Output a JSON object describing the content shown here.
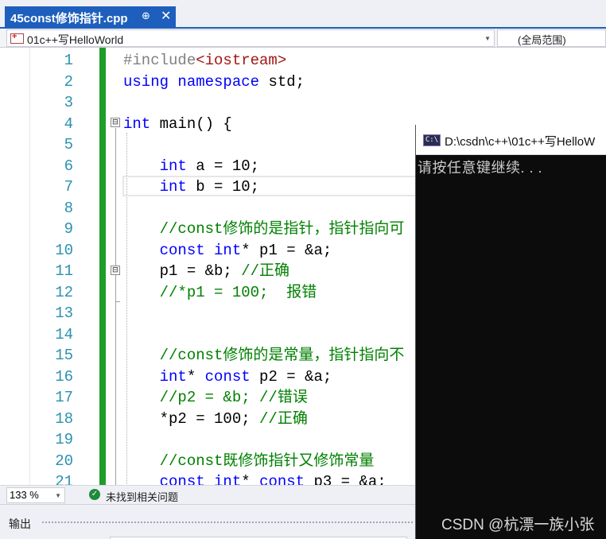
{
  "tab": {
    "title": "45const修饰指针.cpp",
    "pin": "⊕",
    "close": "✕"
  },
  "nav": {
    "project": "01c++写HelloWorld",
    "scope": "(全局范围)",
    "dropdown_glyph": "▼"
  },
  "editor": {
    "line_numbers": [
      "1",
      "2",
      "3",
      "4",
      "5",
      "6",
      "7",
      "8",
      "9",
      "10",
      "11",
      "12",
      "13",
      "14",
      "15",
      "16",
      "17",
      "18",
      "19",
      "20",
      "21"
    ],
    "lines": [
      [
        {
          "t": "#include",
          "c": "pp"
        },
        {
          "t": "<iostream>",
          "c": "inc"
        }
      ],
      [
        {
          "t": "using",
          "c": "kw"
        },
        {
          "t": " "
        },
        {
          "t": "namespace",
          "c": "kw"
        },
        {
          "t": " std;"
        }
      ],
      [],
      [
        {
          "t": "int",
          "c": "kw"
        },
        {
          "t": " main() {"
        }
      ],
      [],
      [
        {
          "t": "    "
        },
        {
          "t": "int",
          "c": "kw"
        },
        {
          "t": " a = 10;"
        }
      ],
      [
        {
          "t": "    "
        },
        {
          "t": "int",
          "c": "kw"
        },
        {
          "t": " b = 10;"
        }
      ],
      [],
      [
        {
          "t": "    "
        },
        {
          "t": "//const修饰的是指针，指针指向可",
          "c": "cm"
        }
      ],
      [
        {
          "t": "    "
        },
        {
          "t": "const",
          "c": "kw"
        },
        {
          "t": " "
        },
        {
          "t": "int",
          "c": "kw"
        },
        {
          "t": "* p1 = &a;"
        }
      ],
      [
        {
          "t": "    p1 = &b; "
        },
        {
          "t": "//正确",
          "c": "cm"
        }
      ],
      [
        {
          "t": "    "
        },
        {
          "t": "//*p1 = 100;  报错",
          "c": "cm"
        }
      ],
      [],
      [],
      [
        {
          "t": "    "
        },
        {
          "t": "//const修饰的是常量，指针指向不",
          "c": "cm"
        }
      ],
      [
        {
          "t": "    "
        },
        {
          "t": "int",
          "c": "kw"
        },
        {
          "t": "* "
        },
        {
          "t": "const",
          "c": "kw"
        },
        {
          "t": " p2 = &a;"
        }
      ],
      [
        {
          "t": "    "
        },
        {
          "t": "//p2 = &b; //错误",
          "c": "cm"
        }
      ],
      [
        {
          "t": "    *p2 = 100; "
        },
        {
          "t": "//正确",
          "c": "cm"
        }
      ],
      [],
      [
        {
          "t": "    "
        },
        {
          "t": "//const既修饰指针又修饰常量",
          "c": "cm"
        }
      ],
      [
        {
          "t": "    "
        },
        {
          "t": "const",
          "c": "kw"
        },
        {
          "t": " "
        },
        {
          "t": "int",
          "c": "kw"
        },
        {
          "t": "* "
        },
        {
          "t": "const",
          "c": "kw"
        },
        {
          "t": " p3 = &a;"
        }
      ]
    ],
    "fold_markers": [
      "⊟",
      "⊟"
    ]
  },
  "console": {
    "icon": "C:\\",
    "title": "D:\\csdn\\c++\\01c++写HelloW",
    "output": "请按任意键继续. . .",
    "watermark": "CSDN @杭漂一族小张"
  },
  "status": {
    "zoom": "133 %",
    "issues_icon": "✓",
    "issues": "未找到相关问题"
  },
  "output_panel": {
    "title": "输出"
  },
  "colors": {
    "accent": "#1e5fbd",
    "change_bar": "#1f9d2a",
    "keyword": "#0000ff",
    "comment": "#008000",
    "line_number": "#2b91af",
    "console_bg": "#0c0c0c"
  }
}
